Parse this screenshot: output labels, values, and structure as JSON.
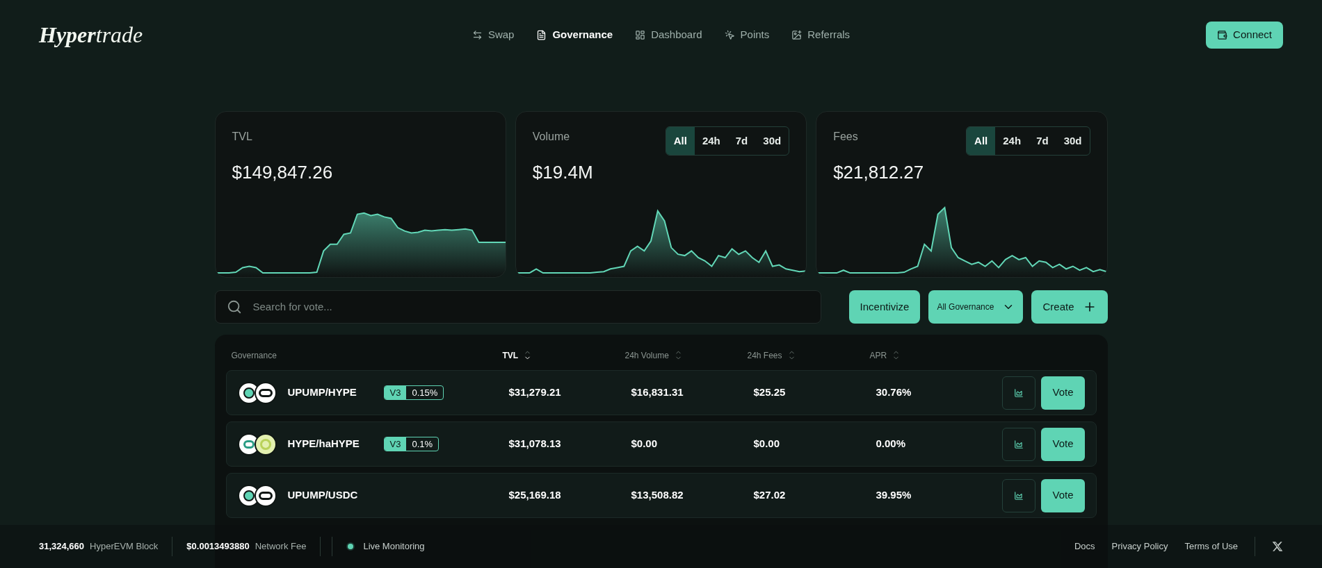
{
  "brand": {
    "bold": "Hyper",
    "light": "trade"
  },
  "nav": [
    {
      "label": "Swap",
      "selected": false
    },
    {
      "label": "Governance",
      "selected": true
    },
    {
      "label": "Dashboard",
      "selected": false
    },
    {
      "label": "Points",
      "selected": false
    },
    {
      "label": "Referrals",
      "selected": false
    }
  ],
  "connect": "Connect",
  "cards": [
    {
      "title": "TVL",
      "value": "$149,847.26"
    },
    {
      "title": "Volume",
      "value": "$19.4M",
      "ranges": [
        {
          "label": "All",
          "selected": true
        },
        {
          "label": "24h",
          "selected": false
        },
        {
          "label": "7d",
          "selected": false
        },
        {
          "label": "30d",
          "selected": false
        }
      ]
    },
    {
      "title": "Fees",
      "value": "$21,812.27",
      "ranges": [
        {
          "label": "All",
          "selected": true
        },
        {
          "label": "24h",
          "selected": false
        },
        {
          "label": "7d",
          "selected": false
        },
        {
          "label": "30d",
          "selected": false
        }
      ]
    }
  ],
  "search": {
    "placeholder": "Search for vote..."
  },
  "actions": {
    "incentivize": "Incentivize",
    "filter": "All Governance",
    "create": "Create"
  },
  "table": {
    "columns": [
      {
        "label": "Governance",
        "kind": "plain"
      },
      {
        "label": "TVL",
        "kind": "sort",
        "selected": true
      },
      {
        "label": "24h Volume",
        "kind": "sort",
        "selected": false
      },
      {
        "label": "24h Fees",
        "kind": "sort",
        "selected": false
      },
      {
        "label": "APR",
        "kind": "sort",
        "selected": false
      }
    ],
    "rows": [
      {
        "pair": "UPUMP/HYPE",
        "version": "V3",
        "fee": "0.15%",
        "tvl": "$31,279.21",
        "volume": "$16,831.31",
        "fees": "$25.25",
        "apr": "30.76%",
        "vote": "Vote"
      },
      {
        "pair": "HYPE/haHYPE",
        "version": "V3",
        "fee": "0.1%",
        "tvl": "$31,078.13",
        "volume": "$0.00",
        "fees": "$0.00",
        "apr": "0.00%",
        "vote": "Vote"
      },
      {
        "pair": "UPUMP/USDC",
        "tvl": "$25,169.18",
        "volume": "$13,508.82",
        "fees": "$27.02",
        "apr": "39.95%",
        "vote": "Vote"
      }
    ]
  },
  "status_bar": {
    "stats": [
      {
        "value": "31,324,660",
        "label": "HyperEVM Block"
      },
      {
        "value": "$0.0013493880",
        "label": "Network Fee"
      }
    ],
    "monitor": "Live Monitoring",
    "links": [
      "Docs",
      "Privacy Policy",
      "Terms of Use"
    ]
  }
}
